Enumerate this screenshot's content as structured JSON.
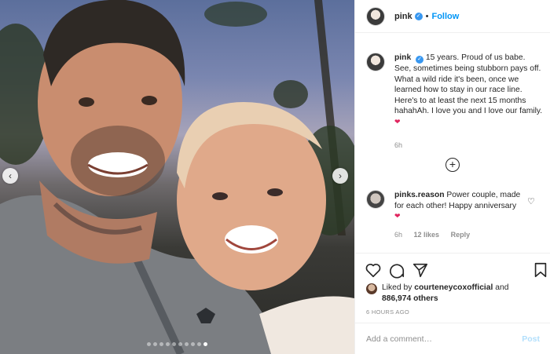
{
  "post": {
    "author": "pink",
    "header_separator": "•",
    "follow_label": "Follow",
    "caption": "15 years. Proud of us babe. See, sometimes being stubborn pays off. What a wild ride it's been, once we learned how to stay in our race line. Here's to at least the next 15 months hahahAh. I love you and I love our family.",
    "caption_emoji": "heart",
    "caption_time": "6h",
    "load_more_icon": "plus-circle-icon"
  },
  "comment": {
    "user": "pinks.reason",
    "text": "Power couple, made for each other! Happy anniversary",
    "emoji": "heart",
    "time": "6h",
    "likes": "12 likes",
    "reply_label": "Reply"
  },
  "engagement": {
    "liked_by_prefix": "Liked by",
    "liked_by_user": "courteneycoxofficial",
    "liked_by_joiner": "and",
    "others": "886,974 others",
    "date": "6 HOURS AGO"
  },
  "comment_input": {
    "placeholder": "Add a comment…",
    "post_label": "Post"
  },
  "carousel": {
    "slide_count": 10,
    "active_index": 9
  },
  "colors": {
    "accent": "#0095f6",
    "verified": "#3897f0",
    "heart": "#e0245e"
  }
}
